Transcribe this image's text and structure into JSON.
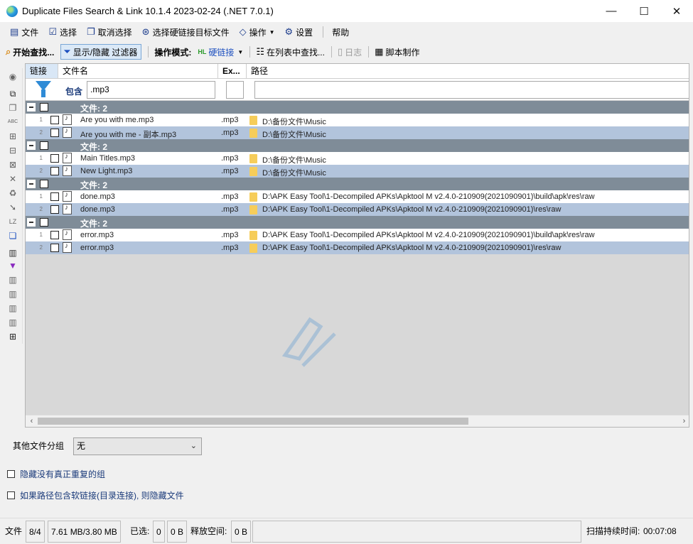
{
  "window": {
    "title": "Duplicate Files Search & Link 10.1.4 2023-02-24 (.NET 7.0.1)",
    "minimize": "—",
    "maximize": "☐",
    "close": "✕"
  },
  "menu": {
    "file": "文件",
    "select": "选择",
    "deselect": "取消选择",
    "select_hardlink": "选择硬链接目标文件",
    "operations": "操作",
    "settings": "设置",
    "help": "帮助"
  },
  "toolbar": {
    "start_search": "开始查找...",
    "toggle_filter": "显示/隐藏 过滤器",
    "operation_mode_label": "操作模式:",
    "mode_value": "硬链接",
    "find_in_list": "在列表中查找...",
    "log": "日志",
    "script": "脚本制作"
  },
  "grid": {
    "columns": {
      "link": "链接",
      "name": "文件名",
      "ext": "Ex...",
      "path": "路径"
    },
    "filter": {
      "label": "包含",
      "name_value": ".mp3",
      "ext_value": "",
      "path_value": ""
    },
    "group_label": "文件: 2",
    "groups": [
      {
        "files": [
          {
            "num": "1",
            "name": "Are you with me.mp3",
            "ext": ".mp3",
            "path": "D:\\备份文件\\Music"
          },
          {
            "num": "2",
            "name": "Are you with me - 副本.mp3",
            "ext": ".mp3",
            "path": "D:\\备份文件\\Music"
          }
        ]
      },
      {
        "files": [
          {
            "num": "1",
            "name": "Main Titles.mp3",
            "ext": ".mp3",
            "path": "D:\\备份文件\\Music"
          },
          {
            "num": "2",
            "name": "New Light.mp3",
            "ext": ".mp3",
            "path": "D:\\备份文件\\Music"
          }
        ]
      },
      {
        "files": [
          {
            "num": "1",
            "name": "done.mp3",
            "ext": ".mp3",
            "path": "D:\\APK Easy Tool\\1-Decompiled APKs\\Apktool M v2.4.0-210909(2021090901)\\build\\apk\\res\\raw"
          },
          {
            "num": "2",
            "name": "done.mp3",
            "ext": ".mp3",
            "path": "D:\\APK Easy Tool\\1-Decompiled APKs\\Apktool M v2.4.0-210909(2021090901)\\res\\raw"
          }
        ]
      },
      {
        "files": [
          {
            "num": "1",
            "name": "error.mp3",
            "ext": ".mp3",
            "path": "D:\\APK Easy Tool\\1-Decompiled APKs\\Apktool M v2.4.0-210909(2021090901)\\build\\apk\\res\\raw"
          },
          {
            "num": "2",
            "name": "error.mp3",
            "ext": ".mp3",
            "path": "D:\\APK Easy Tool\\1-Decompiled APKs\\Apktool M v2.4.0-210909(2021090901)\\res\\raw"
          }
        ]
      }
    ]
  },
  "options": {
    "other_group_label": "其他文件分组",
    "other_group_value": "无",
    "hide_non_dup": "隐藏没有真正重复的组",
    "hide_softlink": "如果路径包含软链接(目录连接), 则隐藏文件"
  },
  "status": {
    "files_label": "文件",
    "files_count": "8/4",
    "size": "7.61 MB/3.80 MB",
    "selected_label": "已选:",
    "selected_count": "0",
    "selected_size": "0 B",
    "free_label": "释放空间:",
    "free_value": "0 B",
    "duration_label": "扫描持续时间:",
    "duration_value": "00:07:08"
  },
  "colors": {
    "group_row": "#7f8c98",
    "alt_row": "#b2c4dc",
    "accent": "#1c4fbf"
  }
}
